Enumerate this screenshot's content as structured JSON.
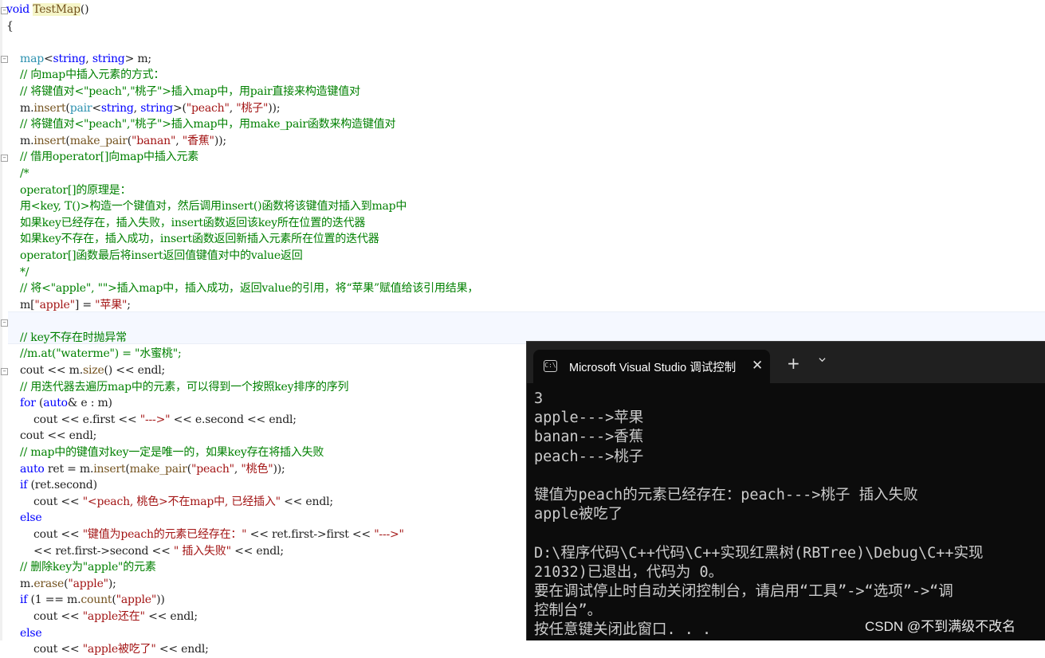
{
  "editor": {
    "lines": [
      [
        [
          "kw",
          "void"
        ],
        [
          "op",
          " "
        ],
        [
          "fn hl",
          "TestMap"
        ],
        [
          "op",
          "()"
        ]
      ],
      [
        [
          "op",
          "{"
        ]
      ],
      [
        [
          "op",
          ""
        ]
      ],
      [
        [
          "op",
          "    "
        ],
        [
          "ty",
          "map"
        ],
        [
          "op",
          "<"
        ],
        [
          "kw",
          "string"
        ],
        [
          "op",
          ", "
        ],
        [
          "kw",
          "string"
        ],
        [
          "op",
          "> m;"
        ]
      ],
      [
        [
          "cm",
          "    // 向map中插入元素的方式："
        ]
      ],
      [
        [
          "cm",
          "    // 将键值对<\"peach\",\"桃子\">插入map中，用pair直接来构造键值对"
        ]
      ],
      [
        [
          "op",
          "    m."
        ],
        [
          "fn",
          "insert"
        ],
        [
          "op",
          "("
        ],
        [
          "ty",
          "pair"
        ],
        [
          "op",
          "<"
        ],
        [
          "kw",
          "string"
        ],
        [
          "op",
          ", "
        ],
        [
          "kw",
          "string"
        ],
        [
          "op",
          ">("
        ],
        [
          "str",
          "\"peach\""
        ],
        [
          "op",
          ", "
        ],
        [
          "str",
          "\"桃子\""
        ],
        [
          "op",
          "));"
        ]
      ],
      [
        [
          "cm",
          "    // 将键值对<\"peach\",\"桃子\">插入map中，用make_pair函数来构造键值对"
        ]
      ],
      [
        [
          "op",
          "    m."
        ],
        [
          "fn",
          "insert"
        ],
        [
          "op",
          "("
        ],
        [
          "fn",
          "make_pair"
        ],
        [
          "op",
          "("
        ],
        [
          "str",
          "\"banan\""
        ],
        [
          "op",
          ", "
        ],
        [
          "str",
          "\"香蕉\""
        ],
        [
          "op",
          "));"
        ]
      ],
      [
        [
          "cm",
          "    // 借用operator[]向map中插入元素"
        ]
      ],
      [
        [
          "cm",
          "    /*"
        ]
      ],
      [
        [
          "cm",
          "    operator[]的原理是："
        ]
      ],
      [
        [
          "cm",
          "    用<key, T()>构造一个键值对，然后调用insert()函数将该键值对插入到map中"
        ]
      ],
      [
        [
          "cm",
          "    如果key已经存在，插入失败，insert函数返回该key所在位置的迭代器"
        ]
      ],
      [
        [
          "cm",
          "    如果key不存在，插入成功，insert函数返回新插入元素所在位置的迭代器"
        ]
      ],
      [
        [
          "cm",
          "    operator[]函数最后将insert返回值键值对中的value返回"
        ]
      ],
      [
        [
          "cm",
          "    */"
        ]
      ],
      [
        [
          "cm",
          "    // 将<\"apple\", \"\">插入map中，插入成功，返回value的引用，将“苹果”赋值给该引用结果，"
        ]
      ],
      [
        [
          "op",
          "    m["
        ],
        [
          "str",
          "\"apple\""
        ],
        [
          "op",
          "] = "
        ],
        [
          "str",
          "\"苹果\""
        ],
        [
          "op",
          ";"
        ]
      ],
      [
        [
          "op",
          ""
        ]
      ],
      [
        [
          "cm",
          "    // key不存在时抛异常"
        ]
      ],
      [
        [
          "cm",
          "    //m.at(\"waterme\") = \"水蜜桃\";"
        ]
      ],
      [
        [
          "op",
          "    cout << m."
        ],
        [
          "fn",
          "size"
        ],
        [
          "op",
          "() << endl;"
        ]
      ],
      [
        [
          "cm",
          "    // 用迭代器去遍历map中的元素，可以得到一个按照key排序的序列"
        ]
      ],
      [
        [
          "op",
          "    "
        ],
        [
          "kw",
          "for"
        ],
        [
          "op",
          " ("
        ],
        [
          "kw",
          "auto"
        ],
        [
          "op",
          "& e : m)"
        ]
      ],
      [
        [
          "op",
          "        cout << e.first << "
        ],
        [
          "str",
          "\"--->\""
        ],
        [
          "op",
          " << e.second << endl;"
        ]
      ],
      [
        [
          "op",
          "    cout << endl;"
        ]
      ],
      [
        [
          "cm",
          "    // map中的键值对key一定是唯一的，如果key存在将插入失败"
        ]
      ],
      [
        [
          "op",
          "    "
        ],
        [
          "kw",
          "auto"
        ],
        [
          "op",
          " ret = m."
        ],
        [
          "fn",
          "insert"
        ],
        [
          "op",
          "("
        ],
        [
          "fn",
          "make_pair"
        ],
        [
          "op",
          "("
        ],
        [
          "str",
          "\"peach\""
        ],
        [
          "op",
          ", "
        ],
        [
          "str",
          "\"桃色\""
        ],
        [
          "op",
          "));"
        ]
      ],
      [
        [
          "op",
          "    "
        ],
        [
          "kw",
          "if"
        ],
        [
          "op",
          " (ret.second)"
        ]
      ],
      [
        [
          "op",
          "        cout << "
        ],
        [
          "str",
          "\"<peach, 桃色>不在map中, 已经插入\""
        ],
        [
          "op",
          " << endl;"
        ]
      ],
      [
        [
          "kw",
          "    else"
        ]
      ],
      [
        [
          "op",
          "        cout << "
        ],
        [
          "str",
          "\"键值为peach的元素已经存在：\""
        ],
        [
          "op",
          " << ret.first->first << "
        ],
        [
          "str",
          "\"--->\""
        ]
      ],
      [
        [
          "op",
          "        << ret.first->second << "
        ],
        [
          "str",
          "\" 插入失败\""
        ],
        [
          "op",
          " << endl;"
        ]
      ],
      [
        [
          "cm",
          "    // 删除key为\"apple\"的元素"
        ]
      ],
      [
        [
          "op",
          "    m."
        ],
        [
          "fn",
          "erase"
        ],
        [
          "op",
          "("
        ],
        [
          "str",
          "\"apple\""
        ],
        [
          "op",
          ");"
        ]
      ],
      [
        [
          "op",
          "    "
        ],
        [
          "kw",
          "if"
        ],
        [
          "op",
          " (1 == m."
        ],
        [
          "fn",
          "count"
        ],
        [
          "op",
          "("
        ],
        [
          "str",
          "\"apple\""
        ],
        [
          "op",
          "))"
        ]
      ],
      [
        [
          "op",
          "        cout << "
        ],
        [
          "str",
          "\"apple还在\""
        ],
        [
          "op",
          " << endl;"
        ]
      ],
      [
        [
          "kw",
          "    else"
        ]
      ],
      [
        [
          "op",
          "        cout << "
        ],
        [
          "str",
          "\"apple被吃了\""
        ],
        [
          "op",
          " << endl;"
        ]
      ]
    ]
  },
  "console": {
    "tab_title": "Microsoft Visual Studio 调试控制台",
    "tab_icon": "C:\\",
    "close_glyph": "✕",
    "new_tab_glyph": "+",
    "lines": [
      "3",
      "apple--->苹果",
      "banan--->香蕉",
      "peach--->桃子",
      "",
      "键值为peach的元素已经存在：peach--->桃子 插入失败",
      "apple被吃了",
      "",
      "D:\\程序代码\\C++代码\\C++实现红黑树(RBTree)\\Debug\\C++实现",
      "21032)已退出，代码为 0。",
      "要在调试停止时自动关闭控制台，请启用“工具”->“选项”->“调",
      "控制台”。",
      "按任意键关闭此窗口. . ."
    ]
  },
  "watermark": "CSDN @不到满级不改名"
}
